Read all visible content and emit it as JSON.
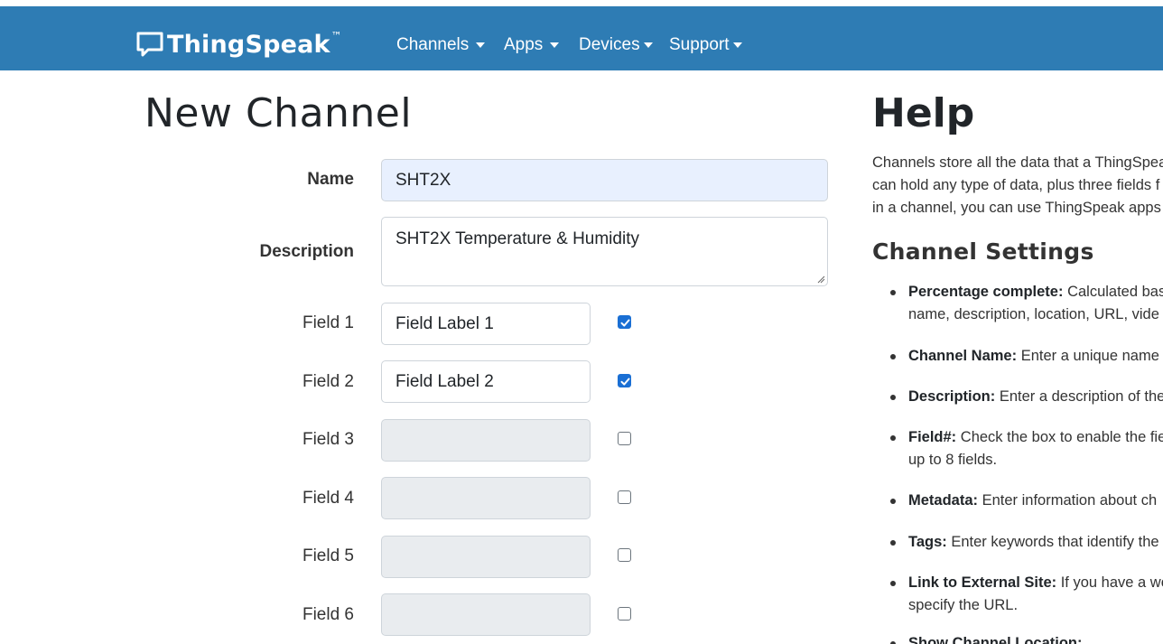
{
  "brand": {
    "name": "ThingSpeak",
    "tm": "™"
  },
  "nav": [
    {
      "label": "Channels"
    },
    {
      "label": "Apps"
    },
    {
      "label": "Devices"
    },
    {
      "label": "Support"
    }
  ],
  "page_title": "New Channel",
  "form": {
    "name_label": "Name",
    "name_value": "SHT2X",
    "description_label": "Description",
    "description_value": "SHT2X Temperature & Humidity",
    "fields": [
      {
        "label": "Field 1",
        "value": "Field Label 1",
        "checked": true
      },
      {
        "label": "Field 2",
        "value": "Field Label 2",
        "checked": true
      },
      {
        "label": "Field 3",
        "value": "",
        "checked": false
      },
      {
        "label": "Field 4",
        "value": "",
        "checked": false
      },
      {
        "label": "Field 5",
        "value": "",
        "checked": false
      },
      {
        "label": "Field 6",
        "value": "",
        "checked": false
      }
    ]
  },
  "help": {
    "title": "Help",
    "para_lines": [
      "Channels store all the data that a ThingSpeak",
      "can hold any type of data, plus three fields f",
      "in a channel, you can use ThingSpeak apps"
    ],
    "subtitle": "Channel Settings",
    "items": [
      {
        "term": "Percentage complete:",
        "lines": [
          " Calculated base",
          "name, description, location, URL, vide"
        ]
      },
      {
        "term": "Channel Name:",
        "lines": [
          " Enter a unique name f"
        ]
      },
      {
        "term": "Description:",
        "lines": [
          " Enter a description of the"
        ]
      },
      {
        "term": "Field#:",
        "lines": [
          " Check the box to enable the fie",
          "up to 8 fields."
        ]
      },
      {
        "term": "Metadata:",
        "lines": [
          " Enter information about ch"
        ]
      },
      {
        "term": "Tags:",
        "lines": [
          " Enter keywords that identify the"
        ]
      },
      {
        "term": "Link to External Site:",
        "lines": [
          " If you have a web",
          "specify the URL."
        ]
      },
      {
        "term": "Show Channel Location:",
        "lines": [
          ""
        ]
      }
    ]
  },
  "colors": {
    "navbar": "#2e7cb4",
    "checkbox_checked": "#1a6fd4",
    "name_input_bg": "#e8f0fe",
    "disabled_input_bg": "#e9ecef"
  }
}
